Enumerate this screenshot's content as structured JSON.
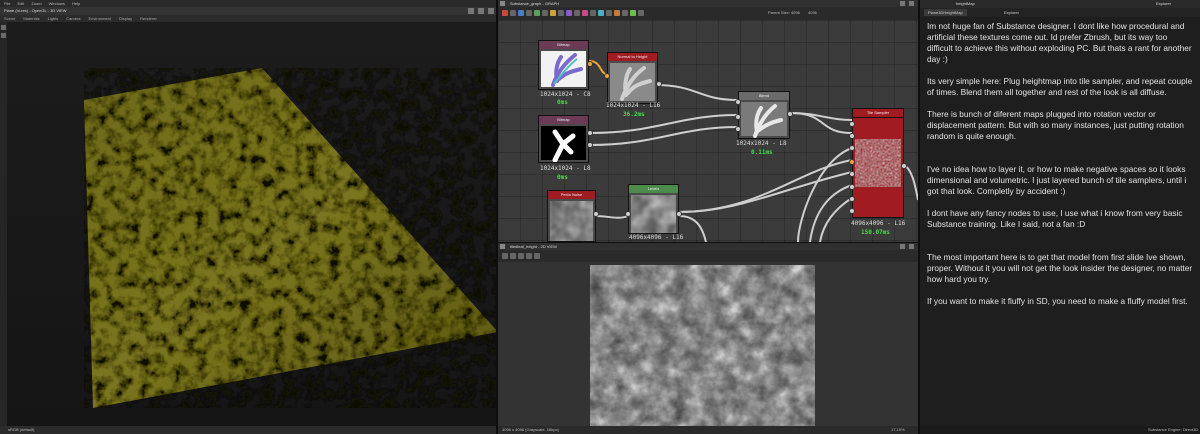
{
  "menubar": {
    "items": [
      "File",
      "Edit",
      "Zoom",
      "Windows",
      "Help"
    ]
  },
  "panel3d": {
    "title": "Plane (hi-res) - OpenGL - 3D VIEW",
    "menu": [
      "Scene",
      "Materials",
      "Lights",
      "Camera",
      "Environment",
      "Display",
      "Renderer"
    ],
    "status": "sRGB (default)"
  },
  "graph": {
    "title": "Substance_graph - GRAPH",
    "toolbar_label": "Parent Size: 4096",
    "toolbar_value": "4096",
    "nodes": [
      {
        "name": "Bitmap",
        "res": "1024x1024 - C8",
        "time": "0ms"
      },
      {
        "name": "Normal to Height",
        "res": "1024x1024 - L16",
        "time": "36.2ms"
      },
      {
        "name": "Bitmap",
        "res": "1024x1024 - L8",
        "time": "0ms"
      },
      {
        "name": "Blend",
        "res": "1024x1024 - L8",
        "time": "0.11ms"
      },
      {
        "name": "Tile Sampler",
        "res": "4096x4096 - L16",
        "time": "150.07ms"
      },
      {
        "name": "Perlin Noise",
        "res": "",
        "time": ""
      },
      {
        "name": "Levels",
        "res": "4096x4096 - L16",
        "time": ""
      }
    ],
    "colors": {
      "bitmap_header": "#6b3a55",
      "red_header": "#a11c22",
      "gray_header": "#6a6a6a",
      "green_header": "#4d8a4d",
      "time_green": "#43e043",
      "port_orange": "#e8a33a"
    }
  },
  "view2d": {
    "title": "tiledleaf_height - 2D VIEW",
    "status": "4096 x 4096 (Grayscale, 16bpc)",
    "zoom": "17.19%"
  },
  "textpanel": {
    "title": "heightMap",
    "tabs": [
      "Plane3DHeightMap",
      "Explorer"
    ],
    "explorer_title": "Explorer",
    "paragraphs": [
      "Im not huge fan of Substance designer. I dont like how procedural and artificial these textures come out. Id prefer Zbrush, but its way too difficult to achieve this without exploding PC. But thats a rant for another day :)",
      "Its very simple here: Plug heightmap into tile sampler, and repeat couple of times. Blend them all together and rest of the look is all diffuse.",
      "There is bunch of diferent maps plugged into rotation vector or displacement pattern. But with so many instances, just putting rotation random is quite enough.",
      "I've no idea how to layer it, or how to make negative spaces so it looks dimensional and volumetric. I just layered bunch of tile samplers, until i got that look. Completly  by accident :)",
      "I dont have any fancy nodes to use, I use what i know from very basic Substance training. Like I said, not a fan :D",
      "The most important here is to get that model from first slide Ive shown, proper. Without it you will not get the look insider the designer, no matter how hard you try.",
      "If you want to make it fluffy in SD, you need to make a fluffy model first."
    ],
    "status": "Substance Engine: Direct3D"
  }
}
